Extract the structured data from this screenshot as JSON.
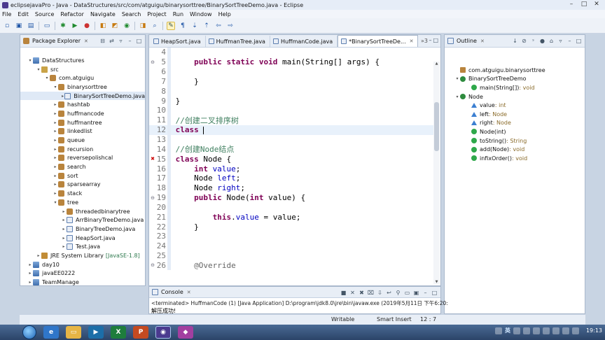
{
  "window": {
    "title": "eclipsejavaPro - Java - DataStructures/src/com/atguigu/binarysorttree/BinarySortTreeDemo.java - Eclipse",
    "controls": {
      "minimize": "–",
      "maximize": "□",
      "close": "✕"
    }
  },
  "menu": [
    "File",
    "Edit",
    "Source",
    "Refactor",
    "Navigate",
    "Search",
    "Project",
    "Run",
    "Window",
    "Help"
  ],
  "toolbar": {
    "icons": [
      "new-icon",
      "save-icon",
      "save-all-icon",
      "print-icon",
      "debug-icon",
      "run-icon",
      "external-tools-icon",
      "new-java-project-icon",
      "new-package-icon",
      "new-class-icon",
      "open-type-icon",
      "search-icon",
      "toggle-mark-occurrences-icon",
      "show-whitespace-icon",
      "next-annotation-icon",
      "previous-annotation-icon",
      "back-icon",
      "forward-icon"
    ]
  },
  "package_explorer": {
    "title": "Package Explorer",
    "tree": [
      {
        "label": "DataStructures",
        "kind": "proj",
        "indent": 0,
        "twisty": "▾"
      },
      {
        "label": "src",
        "kind": "src",
        "indent": 1,
        "twisty": "▾"
      },
      {
        "label": "com.atguigu",
        "kind": "pkg",
        "indent": 2,
        "twisty": "▾"
      },
      {
        "label": "binarysorttree",
        "kind": "pkg",
        "indent": 3,
        "twisty": "▾"
      },
      {
        "label": "BinarySortTreeDemo.java",
        "kind": "java",
        "indent": 4,
        "twisty": "▸",
        "selected": true
      },
      {
        "label": "hashtab",
        "kind": "pkg",
        "indent": 3,
        "twisty": "▸"
      },
      {
        "label": "huffmancode",
        "kind": "pkg",
        "indent": 3,
        "twisty": "▸"
      },
      {
        "label": "huffmantree",
        "kind": "pkg",
        "indent": 3,
        "twisty": "▸"
      },
      {
        "label": "linkedlist",
        "kind": "pkg",
        "indent": 3,
        "twisty": "▸"
      },
      {
        "label": "queue",
        "kind": "pkg",
        "indent": 3,
        "twisty": "▸"
      },
      {
        "label": "recursion",
        "kind": "pkg",
        "indent": 3,
        "twisty": "▸"
      },
      {
        "label": "reversepolishcal",
        "kind": "pkg",
        "indent": 3,
        "twisty": "▸"
      },
      {
        "label": "search",
        "kind": "pkg",
        "indent": 3,
        "twisty": "▸"
      },
      {
        "label": "sort",
        "kind": "pkg",
        "indent": 3,
        "twisty": "▸"
      },
      {
        "label": "sparsearray",
        "kind": "pkg",
        "indent": 3,
        "twisty": "▸"
      },
      {
        "label": "stack",
        "kind": "pkg",
        "indent": 3,
        "twisty": "▸"
      },
      {
        "label": "tree",
        "kind": "pkg",
        "indent": 3,
        "twisty": "▾"
      },
      {
        "label": "threadedbinarytree",
        "kind": "pkg",
        "indent": 4,
        "twisty": "▸"
      },
      {
        "label": "ArrBinaryTreeDemo.java",
        "kind": "java",
        "indent": 4,
        "twisty": "▸"
      },
      {
        "label": "BinaryTreeDemo.java",
        "kind": "java",
        "indent": 4,
        "twisty": "▸"
      },
      {
        "label": "HeapSort.java",
        "kind": "java",
        "indent": 4,
        "twisty": "▸"
      },
      {
        "label": "Test.java",
        "kind": "java",
        "indent": 4,
        "twisty": "▸"
      },
      {
        "label": "JRE System Library",
        "kind": "lib",
        "indent": 1,
        "twisty": "▸",
        "suffix": "[JavaSE-1.8]"
      },
      {
        "label": "day10",
        "kind": "proj",
        "indent": 0,
        "twisty": "▸"
      },
      {
        "label": "javaEE0222",
        "kind": "proj",
        "indent": 0,
        "twisty": "▸"
      },
      {
        "label": "TeamManage",
        "kind": "proj",
        "indent": 0,
        "twisty": "▸"
      }
    ]
  },
  "editor": {
    "tabs": [
      {
        "label": "HeapSort.java",
        "active": false
      },
      {
        "label": "HuffmanTree.java",
        "active": false
      },
      {
        "label": "HuffmanCode.java",
        "active": false
      },
      {
        "label": "*BinarySortTreeDe...",
        "active": true
      }
    ],
    "overflow": "»3",
    "lines": [
      {
        "n": "4",
        "html": ""
      },
      {
        "n": "5",
        "marker": "⊖",
        "html": "    <span class=\"kw\">public static void</span> main(String[] args) {"
      },
      {
        "n": "6",
        "html": ""
      },
      {
        "n": "7",
        "html": "    }"
      },
      {
        "n": "8",
        "html": ""
      },
      {
        "n": "9",
        "html": "}"
      },
      {
        "n": "10",
        "html": ""
      },
      {
        "n": "11",
        "html": "<span class=\"cmt\">//创建二叉排序树</span>"
      },
      {
        "n": "12",
        "html": "<span class=\"kw\">class</span> <span class=\"caret\"></span>",
        "current": true
      },
      {
        "n": "13",
        "html": ""
      },
      {
        "n": "14",
        "html": "<span class=\"cmt\">//创建Node结点</span>"
      },
      {
        "n": "15",
        "marker": "✖",
        "html": "<span class=\"kw\">class</span> Node {"
      },
      {
        "n": "16",
        "html": "    <span class=\"kw\">int</span> <span class=\"fld\">value</span>;"
      },
      {
        "n": "17",
        "html": "    Node <span class=\"fld\">left</span>;"
      },
      {
        "n": "18",
        "html": "    Node <span class=\"fld\">right</span>;"
      },
      {
        "n": "19",
        "marker": "⊖",
        "html": "    <span class=\"kw\">public</span> Node(<span class=\"kw\">int</span> value) {"
      },
      {
        "n": "20",
        "html": ""
      },
      {
        "n": "21",
        "html": "        <span class=\"kw\">this</span>.<span class=\"fld\">value</span> = value;"
      },
      {
        "n": "22",
        "html": "    }"
      },
      {
        "n": "23",
        "html": ""
      },
      {
        "n": "24",
        "html": ""
      },
      {
        "n": "25",
        "html": ""
      },
      {
        "n": "26",
        "marker": "⊖",
        "html": "    <span class=\"ann\">@Override</span>"
      }
    ]
  },
  "outline": {
    "title": "Outline",
    "items": [
      {
        "label": "com.atguigu.binarysorttree",
        "icon": "pkg",
        "indent": 0,
        "twisty": ""
      },
      {
        "label": "BinarySortTreeDemo",
        "icon": "cls",
        "indent": 0,
        "twisty": "▾"
      },
      {
        "label": "main(String[])",
        "type": " : void",
        "icon": "meth",
        "indent": 1,
        "twisty": ""
      },
      {
        "label": "Node",
        "icon": "cls",
        "indent": 0,
        "twisty": "▾"
      },
      {
        "label": "value",
        "type": " : int",
        "icon": "fld",
        "indent": 1,
        "twisty": ""
      },
      {
        "label": "left",
        "type": " : Node",
        "icon": "fld",
        "indent": 1,
        "twisty": ""
      },
      {
        "label": "right",
        "type": " : Node",
        "icon": "fld",
        "indent": 1,
        "twisty": ""
      },
      {
        "label": "Node(int)",
        "icon": "meth",
        "indent": 1,
        "twisty": ""
      },
      {
        "label": "toString()",
        "type": " : String",
        "icon": "meth",
        "indent": 1,
        "twisty": ""
      },
      {
        "label": "add(Node)",
        "type": " : void",
        "icon": "meth",
        "indent": 1,
        "twisty": ""
      },
      {
        "label": "infixOrder()",
        "type": " : void",
        "icon": "meth",
        "indent": 1,
        "twisty": ""
      }
    ]
  },
  "console": {
    "title": "Console",
    "terminated": "<terminated> HuffmanCode (1) [Java Application] D:\\program\\jdk8.0\\jre\\bin\\javaw.exe (2019年5月11日 下午6:20:",
    "output": "解压成功!"
  },
  "status": {
    "writable": "Writable",
    "insert_mode": "Smart Insert",
    "position": "12 : 7"
  },
  "taskbar": {
    "lang": "英",
    "clock": "19:13"
  }
}
